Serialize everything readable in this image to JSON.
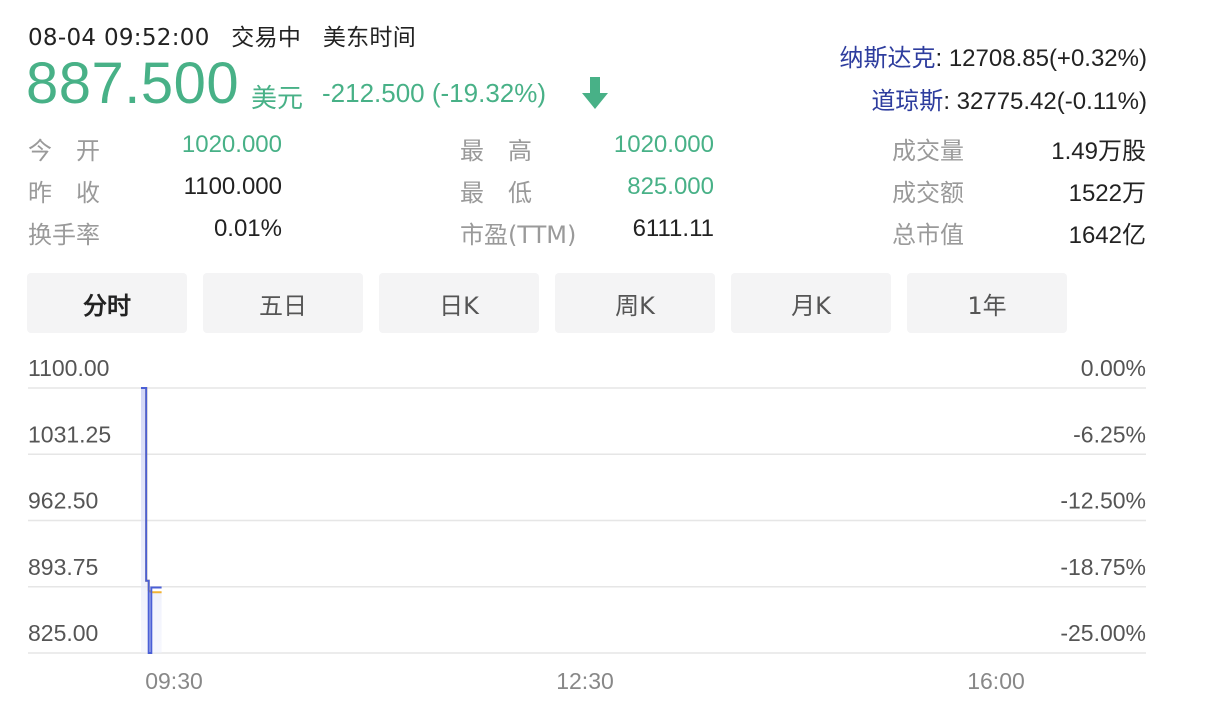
{
  "status": {
    "datetime": "08-04 09:52:00",
    "trading_state": "交易中",
    "timezone": "美东时间"
  },
  "quote": {
    "price": "887.500",
    "currency": "美元",
    "change": "-212.500 (-19.32%)",
    "direction_icon": "arrow-down-icon",
    "color_down": "#48b187"
  },
  "indices": [
    {
      "name": "纳斯达克",
      "value": ": 12708.85(+0.32%)"
    },
    {
      "name": "道琼斯",
      "value": ": 32775.42(-0.11%)"
    }
  ],
  "stats": {
    "col1": [
      {
        "label": "今　开",
        "value": "1020.000",
        "color": "green"
      },
      {
        "label": "昨　收",
        "value": "1100.000",
        "color": "dark"
      },
      {
        "label": "换手率",
        "value": "0.01%",
        "color": "dark"
      }
    ],
    "col2": [
      {
        "label": "最　高",
        "value": "1020.000",
        "color": "green"
      },
      {
        "label": "最　低",
        "value": "825.000",
        "color": "green"
      },
      {
        "label": "市盈(TTM)",
        "value": "6111.11",
        "color": "dark"
      }
    ],
    "col3": [
      {
        "label": "成交量",
        "value": "1.49万股",
        "color": "dark"
      },
      {
        "label": "成交额",
        "value": "1522万",
        "color": "dark"
      },
      {
        "label": "总市值",
        "value": "1642亿",
        "color": "dark"
      }
    ]
  },
  "tabs": [
    {
      "label": "分时",
      "active": true
    },
    {
      "label": "五日",
      "active": false
    },
    {
      "label": "日K",
      "active": false
    },
    {
      "label": "周K",
      "active": false
    },
    {
      "label": "月K",
      "active": false
    },
    {
      "label": "1年",
      "active": false
    }
  ],
  "chart_data": {
    "type": "line",
    "y_price_ticks": [
      "1100.00",
      "1031.25",
      "962.50",
      "893.75",
      "825.00"
    ],
    "y_pct_ticks": [
      "0.00%",
      "-6.25%",
      "-12.50%",
      "-18.75%",
      "-25.00%"
    ],
    "x_ticks": [
      "09:30",
      "12:30",
      "16:00"
    ],
    "ylim": [
      825.0,
      1100.0
    ],
    "session_minutes": 390,
    "grid": true,
    "series": [
      {
        "color": "#f2b233",
        "points": [
          [
            0,
            1100
          ],
          [
            2,
            1100
          ],
          [
            2,
            900
          ],
          [
            3,
            900
          ],
          [
            3,
            890
          ],
          [
            4,
            888
          ],
          [
            8,
            888
          ]
        ]
      },
      {
        "color": "#4a5fd6",
        "points": [
          [
            0,
            1100
          ],
          [
            2,
            1100
          ],
          [
            2,
            900
          ],
          [
            3,
            900
          ],
          [
            3,
            825
          ],
          [
            4,
            825
          ],
          [
            4,
            893
          ],
          [
            8,
            893
          ]
        ]
      }
    ]
  }
}
